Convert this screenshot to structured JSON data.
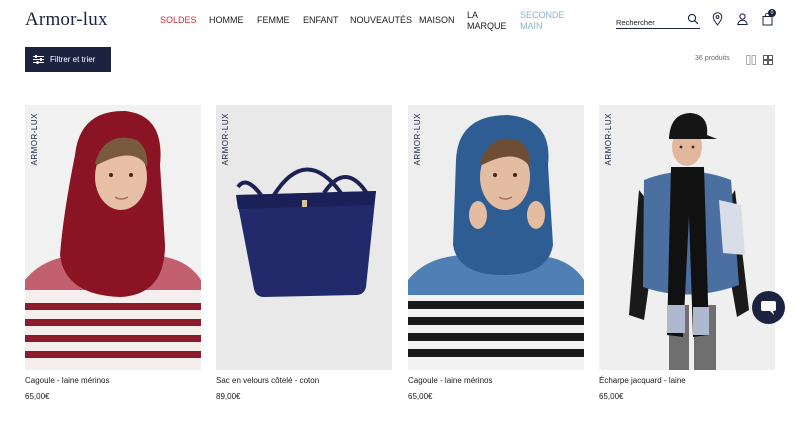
{
  "header": {
    "logo": "Armor-lux",
    "nav": [
      {
        "label": "SOLDES",
        "style": "sale"
      },
      {
        "label": "HOMME",
        "style": "normal"
      },
      {
        "label": "FEMME",
        "style": "normal"
      },
      {
        "label": "ENFANT",
        "style": "normal"
      },
      {
        "label": "NOUVEAUTÉS",
        "style": "normal"
      },
      {
        "label": "MAISON",
        "style": "normal"
      },
      {
        "label_line1": "LA",
        "label_line2": "MARQUE",
        "style": "normal"
      },
      {
        "label_line1": "SECONDE",
        "label_line2": "MAIN",
        "style": "muted"
      }
    ],
    "search_placeholder": "Rechercher",
    "cart_count": "0"
  },
  "toolbar": {
    "filter_label": "Filtrer et trier",
    "product_count": "36 produits"
  },
  "products": [
    {
      "brand": "ARMOR-LUX",
      "name": "Cagoule - laine mérinos",
      "price": "65,00€"
    },
    {
      "brand": "ARMOR-LUX",
      "name": "Sac en velours côtelé - coton",
      "price": "89,00€"
    },
    {
      "brand": "ARMOR-LUX",
      "name": "Cagoule - laine mérinos",
      "price": "65,00€"
    },
    {
      "brand": "ARMOR-LUX",
      "name": "Écharpe jacquard - laine",
      "price": "65,00€"
    }
  ],
  "colors": {
    "navy": "#1b2340",
    "sale_red": "#c8303a",
    "muted_blue": "#8fb3c6"
  }
}
